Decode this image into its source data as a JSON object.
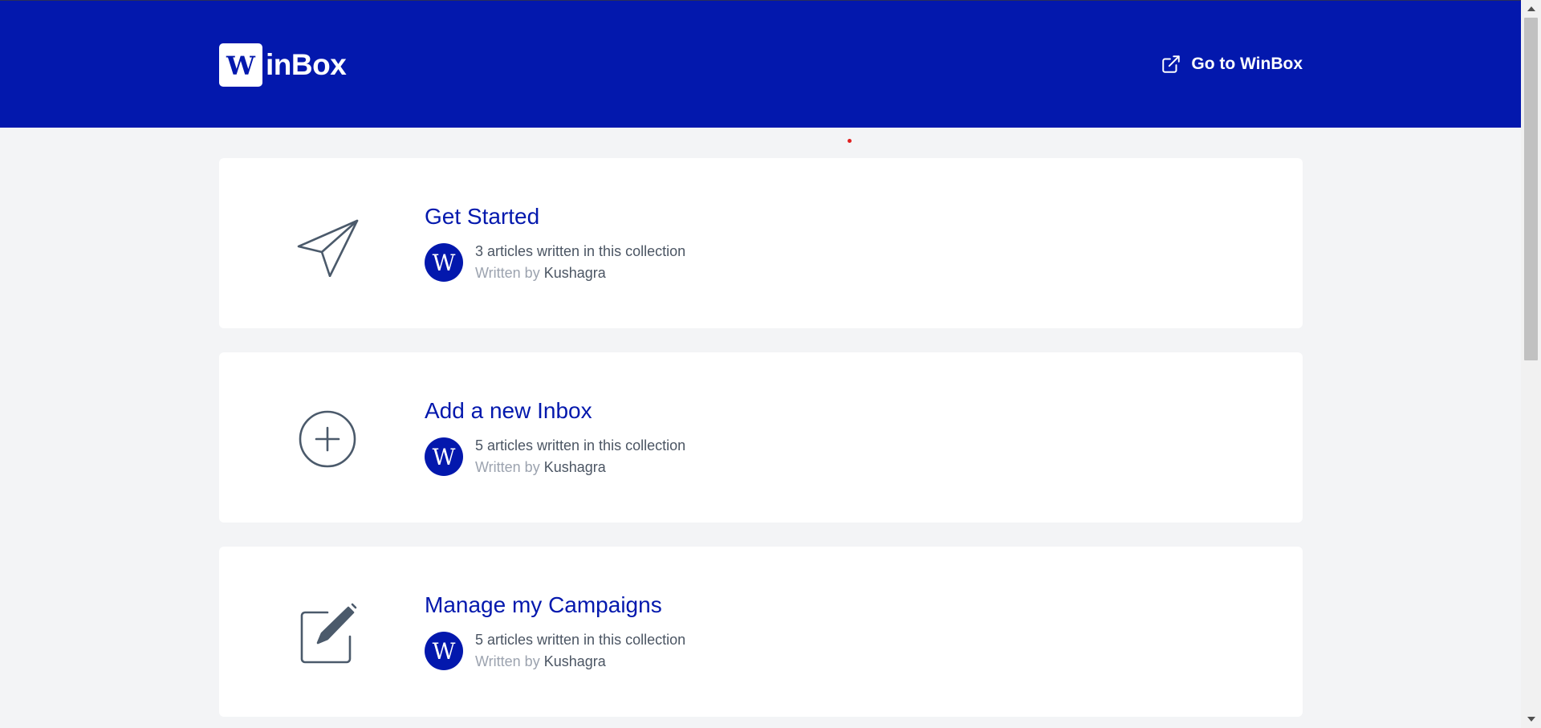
{
  "header": {
    "logo_letter": "W",
    "logo_text": "inBox",
    "go_link_label": "Go to WinBox",
    "go_link_icon": "external-link-icon",
    "background_color": "#0318ad"
  },
  "collections": [
    {
      "icon": "paper-plane-icon",
      "title": "Get Started",
      "article_count_text": "3 articles written in this collection",
      "written_by_label": "Written by",
      "author": "Kushagra",
      "avatar_letter": "W"
    },
    {
      "icon": "plus-circle-icon",
      "title": "Add a new Inbox",
      "article_count_text": "5 articles written in this collection",
      "written_by_label": "Written by",
      "author": "Kushagra",
      "avatar_letter": "W"
    },
    {
      "icon": "edit-pencil-icon",
      "title": "Manage my Campaigns",
      "article_count_text": "5 articles written in this collection",
      "written_by_label": "Written by",
      "author": "Kushagra",
      "avatar_letter": "W"
    }
  ],
  "colors": {
    "brand": "#0318ad",
    "page_background": "#f3f4f6",
    "icon_stroke": "#4b5a6b",
    "muted_text": "#9ca3af",
    "body_text": "#4b5563"
  }
}
